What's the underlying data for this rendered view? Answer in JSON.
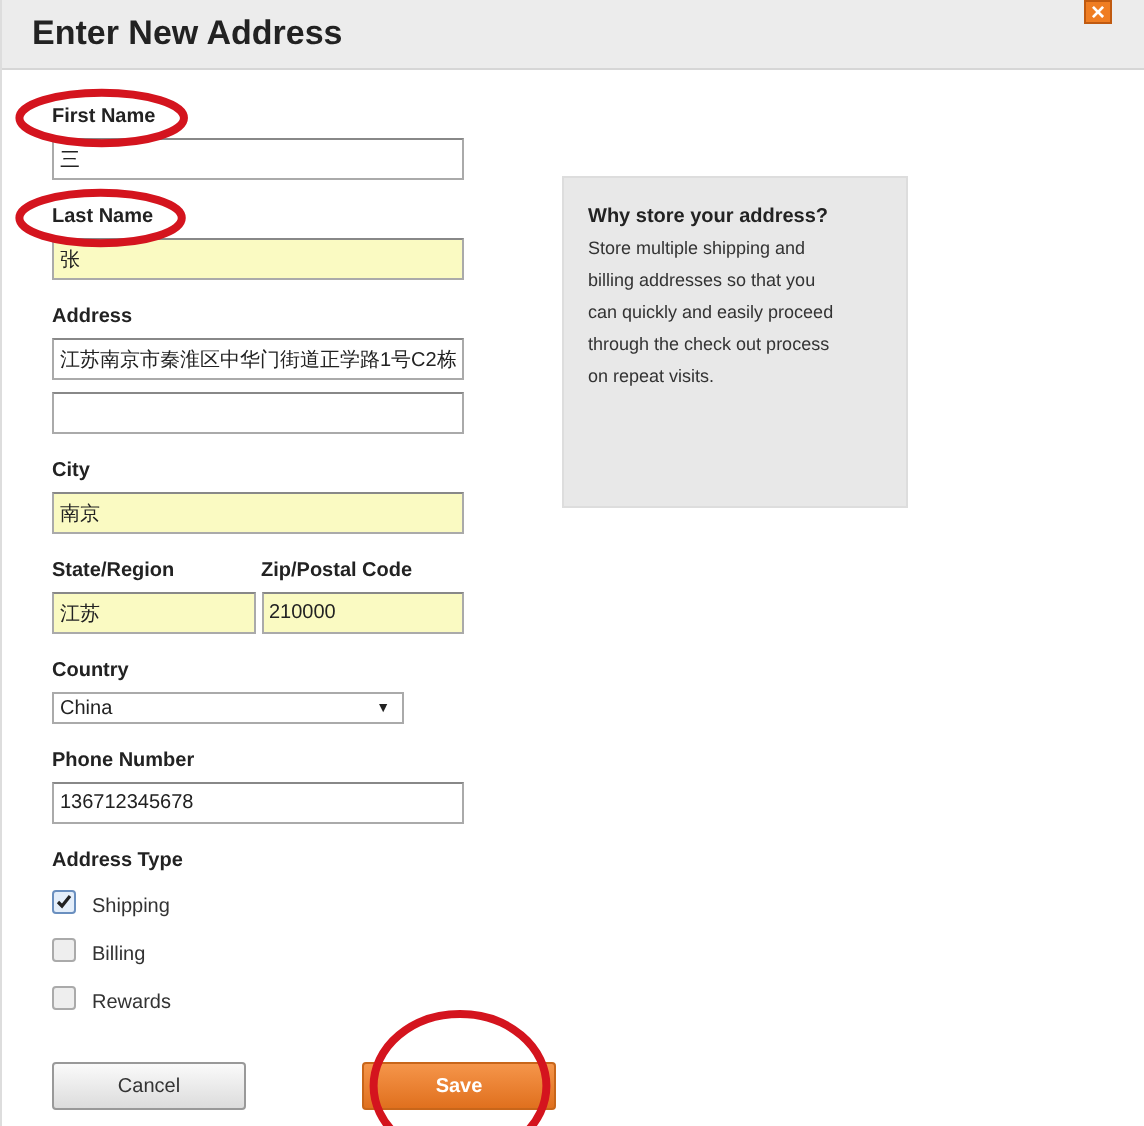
{
  "dialog": {
    "title": "Enter New Address",
    "close": "×"
  },
  "fields": [
    {
      "kind": "text",
      "label": "First Name",
      "highlighted": true,
      "inputs": [
        {
          "value": "三",
          "autofilled": false
        }
      ]
    },
    {
      "kind": "text",
      "label": "Last Name",
      "highlighted": true,
      "inputs": [
        {
          "value": "张",
          "autofilled": true
        }
      ]
    },
    {
      "kind": "text",
      "label": "Address",
      "highlighted": false,
      "inputs": [
        {
          "value": "江苏南京市秦淮区中华门街道正学路1号C2栋",
          "autofilled": false
        },
        {
          "autofilled": false
        }
      ]
    },
    {
      "kind": "text",
      "label": "City",
      "highlighted": false,
      "inputs": [
        {
          "value": "南京",
          "autofilled": true
        }
      ]
    },
    {
      "kind": "pair",
      "items": [
        {
          "label": "State/Region",
          "value": "江苏",
          "autofilled": true
        },
        {
          "label": "Zip/Postal Code",
          "value": "210000",
          "autofilled": true
        }
      ]
    },
    {
      "kind": "select",
      "label": "Country",
      "value": "China",
      "caret": "▼"
    },
    {
      "kind": "text",
      "label": "Phone Number",
      "highlighted": false,
      "inputs": [
        {
          "value": "136712345678",
          "autofilled": false
        }
      ]
    }
  ],
  "address_type": {
    "label": "Address Type",
    "options": [
      {
        "label": "Shipping",
        "checked": true
      },
      {
        "label": "Billing",
        "checked": false
      },
      {
        "label": "Rewards",
        "checked": false
      }
    ]
  },
  "info": {
    "title": "Why store your address?",
    "text": "Store multiple shipping and billing addresses so that you can quickly and easily proceed through the check out process on repeat visits."
  },
  "buttons": [
    {
      "kind": "secondary",
      "label": "Cancel",
      "highlighted": false
    },
    {
      "kind": "primary",
      "label": "Save",
      "highlighted": true
    }
  ]
}
